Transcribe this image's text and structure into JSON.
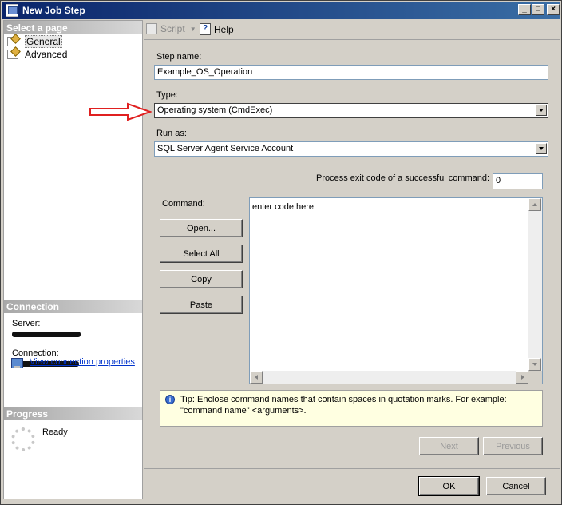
{
  "window": {
    "title": "New Job Step"
  },
  "left_pane": {
    "select_page_header": "Select a page",
    "pages": [
      {
        "label": "General",
        "selected": true
      },
      {
        "label": "Advanced",
        "selected": false
      }
    ],
    "connection_header": "Connection",
    "server_label": "Server:",
    "connection_label": "Connection:",
    "view_connection_link": "View connection properties",
    "progress_header": "Progress",
    "progress_status": "Ready"
  },
  "toolbar": {
    "script_label": "Script",
    "help_label": "Help"
  },
  "form": {
    "step_name_label": "Step name:",
    "step_name_value": "Example_OS_Operation",
    "type_label": "Type:",
    "type_value": "Operating system (CmdExec)",
    "run_as_label": "Run as:",
    "run_as_value": "SQL Server Agent Service Account",
    "exit_code_label": "Process exit code of a successful command:",
    "exit_code_value": "0",
    "command_label": "Command:",
    "command_value": "enter code here",
    "buttons": {
      "open": "Open...",
      "select_all": "Select All",
      "copy": "Copy",
      "paste": "Paste"
    },
    "tip_text": "Tip: Enclose command names that contain spaces in quotation marks. For example: \"command name\" <arguments>.",
    "next_label": "Next",
    "previous_label": "Previous"
  },
  "footer": {
    "ok_label": "OK",
    "cancel_label": "Cancel"
  },
  "colors": {
    "title_bar": "#0a246a",
    "arrow": "#e02020",
    "link": "#0033cc",
    "tip_bg": "#ffffe1"
  }
}
